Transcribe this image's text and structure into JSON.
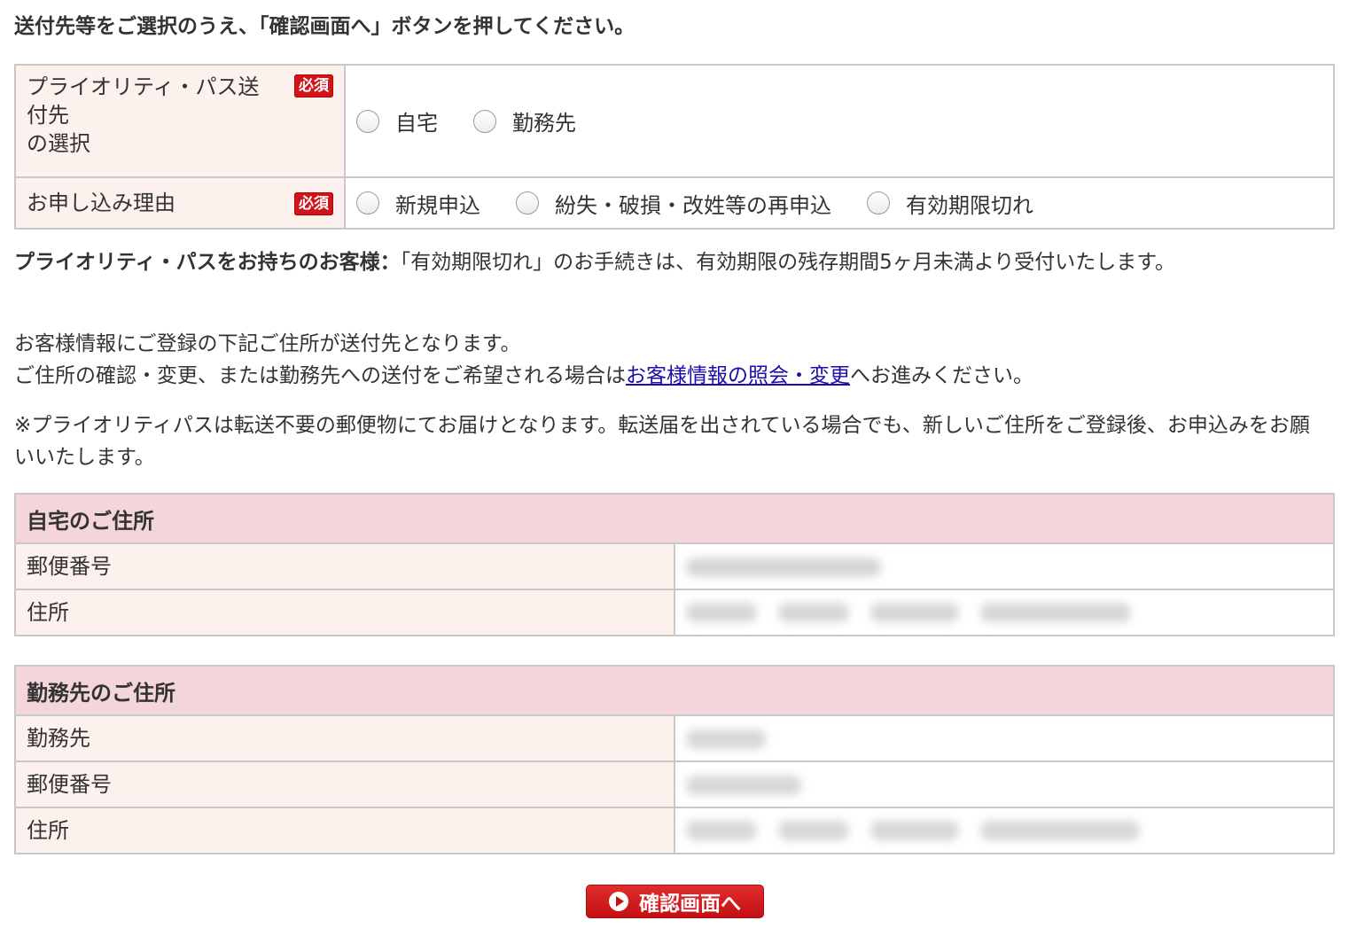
{
  "intro": "送付先等をご選択のうえ、「確認画面へ」ボタンを押してください。",
  "required_label": "必須",
  "destination": {
    "label_line1": "プライオリティ・パス送",
    "label_line2": "付先",
    "label_line3": "の選択",
    "options": [
      "自宅",
      "勤務先"
    ]
  },
  "reason": {
    "label": "お申し込み理由",
    "options": [
      "新規申込",
      "紛失・破損・改姓等の再申込",
      "有効期限切れ"
    ]
  },
  "notice": {
    "bold": "プライオリティ・パスをお持ちのお客様：",
    "text": "「有効期限切れ」のお手続きは、有効期限の残存期間5ヶ月未満より受付いたします。"
  },
  "info": {
    "line1": "お客様情報にご登録の下記ご住所が送付先となります。",
    "line2_prefix": "ご住所の確認・変更、または勤務先への送付をご希望される場合は",
    "link": "お客様情報の照会・変更",
    "line2_suffix": "へお進みください。"
  },
  "note": "※プライオリティパスは転送不要の郵便物にてお届けとなります。転送届を出されている場合でも、新しいご住所をご登録後、お申込みをお願いいたします。",
  "home_address": {
    "header": "自宅のご住所",
    "postal_label": "郵便番号",
    "address_label": "住所"
  },
  "work_address": {
    "header": "勤務先のご住所",
    "company_label": "勤務先",
    "postal_label": "郵便番号",
    "address_label": "住所"
  },
  "confirm_button": "確認画面へ"
}
